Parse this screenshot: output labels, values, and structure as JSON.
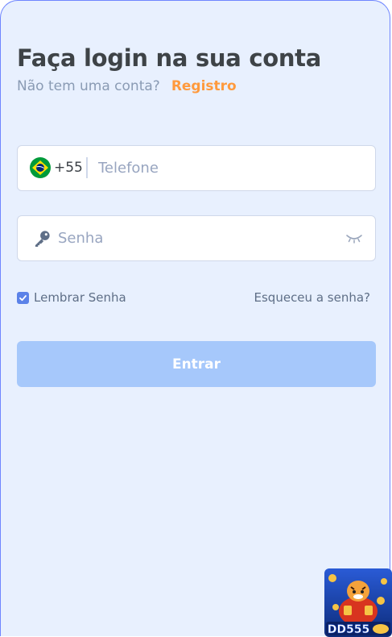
{
  "header": {
    "title": "Faça login na sua conta",
    "subtitle": "Não tem uma conta?",
    "register_link": "Registro"
  },
  "phone": {
    "country_code": "+55",
    "placeholder": "Telefone",
    "value": ""
  },
  "password": {
    "placeholder": "Senha",
    "value": ""
  },
  "options": {
    "remember_label": "Lembrar Senha",
    "remember_checked": true,
    "forgot_label": "Esqueceu a senha?"
  },
  "submit": {
    "label": "Entrar"
  },
  "promo": {
    "brand": "DD555"
  },
  "icons": {
    "flag": "brazil-flag-icon",
    "key": "key-icon",
    "eye": "eye-closed-icon",
    "check": "checkmark-icon"
  },
  "colors": {
    "accent": "#ff9a3d",
    "primary": "#5b82e8",
    "button_disabled": "#a6c8fb",
    "title": "#3e4347",
    "background": "#e8f0fe"
  }
}
